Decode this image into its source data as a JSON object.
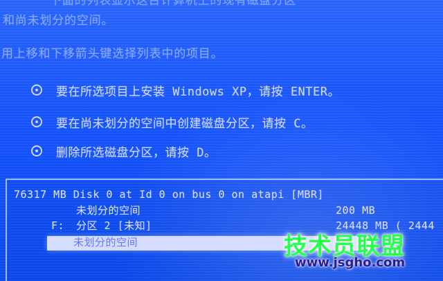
{
  "screen": {
    "top_cut_text": "下面的列表显示这台计算机上的现有磁盘分区",
    "line1": "和尚未划分的空间。",
    "line2": "用上移和下移箭头键选择列表中的项目。",
    "options": [
      "要在所选项目上安装 Windows XP，请按 ENTER。",
      "要在尚未划分的空间中创建磁盘分区，请按 C。",
      "删除所选磁盘分区，请按 D。"
    ]
  },
  "disk_list": {
    "header": "76317 MB Disk 0 at Id 0 on bus 0 on atapi [MBR]",
    "rows": [
      {
        "drive": "",
        "label": "未划分的空间",
        "size": "200 MB"
      },
      {
        "drive": "F:",
        "label": "分区 2 [未知]",
        "size": "24448 MB ( 2444"
      },
      {
        "drive": "",
        "label": "未划分的空间",
        "size": ""
      }
    ]
  },
  "watermark": {
    "logo": "技术员联盟",
    "url": "www.jsgho.com"
  },
  "colors": {
    "background": "#0a59ff",
    "text": "#cfd8ff",
    "selection": "#d6dcff",
    "watermark_green": "#28ff4d",
    "watermark_url": "#2e1a91"
  }
}
